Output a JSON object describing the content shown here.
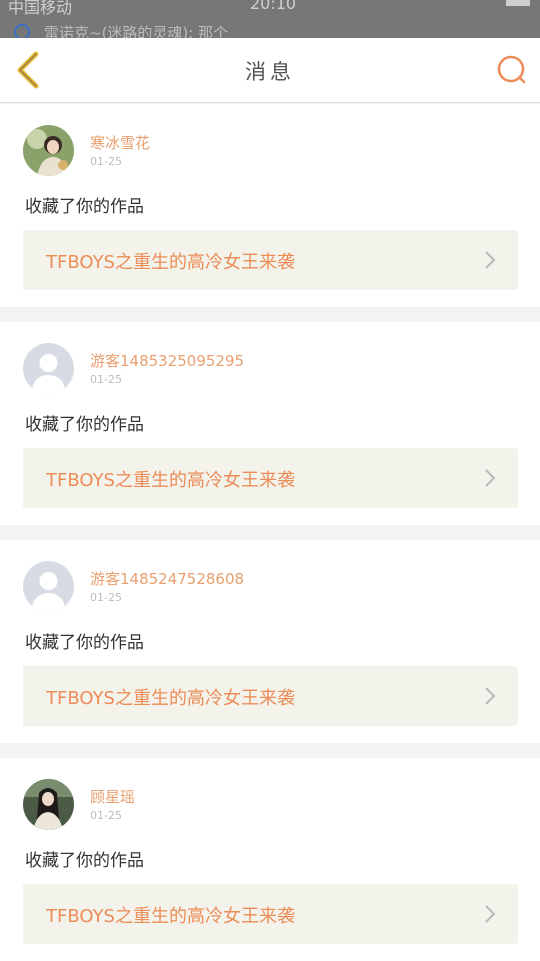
{
  "status_bar": {
    "carrier": "中国移动",
    "time": "20:10",
    "notification": "雷诺克~(迷路的灵魂): 那个"
  },
  "header": {
    "title": "消息"
  },
  "colors": {
    "accent": "#ec8c57",
    "back_arrow": "#e7b83b",
    "username": "#e8a070",
    "link_bg": "#f3f3ec"
  },
  "messages": [
    {
      "username": "寒冰雪花",
      "date": "01-25",
      "action": "收藏了你的作品",
      "work_title": "TFBOYS之重生的高冷女王来袭",
      "avatar": "photo"
    },
    {
      "username": "游客1485325095295",
      "date": "01-25",
      "action": "收藏了你的作品",
      "work_title": "TFBOYS之重生的高冷女王来袭",
      "avatar": "default"
    },
    {
      "username": "游客1485247528608",
      "date": "01-25",
      "action": "收藏了你的作品",
      "work_title": "TFBOYS之重生的高冷女王来袭",
      "avatar": "default"
    },
    {
      "username": "顾星瑶",
      "date": "01-25",
      "action": "收藏了你的作品",
      "work_title": "TFBOYS之重生的高冷女王来袭",
      "avatar": "photo"
    }
  ]
}
